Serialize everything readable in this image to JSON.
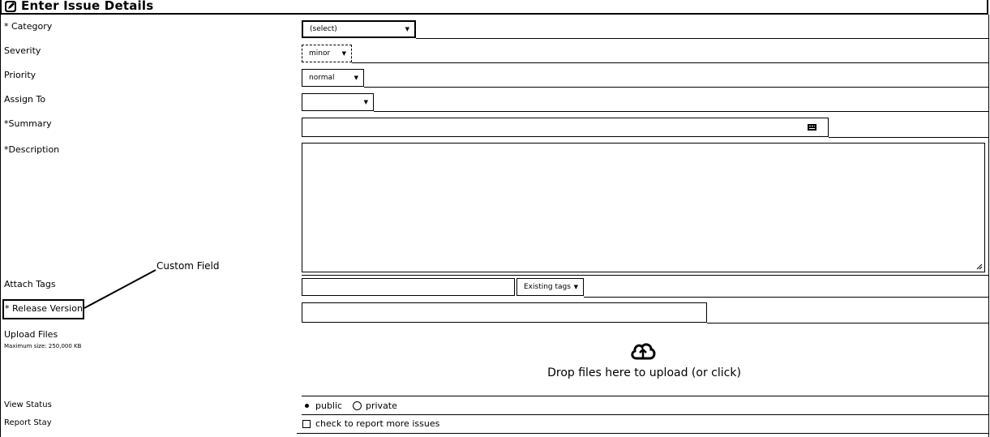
{
  "title": "Enter Issue Details",
  "icons": {
    "title": "edit-icon",
    "summary_field": "keyboard-icon",
    "upload": "cloud-upload-icon",
    "resize": "resize-grip-icon"
  },
  "fields": {
    "category": {
      "label": "* Category",
      "value": "(select)"
    },
    "severity": {
      "label": "Severity",
      "value": "minor"
    },
    "priority": {
      "label": "Priority",
      "value": "normal"
    },
    "assign_to": {
      "label": "Assign To",
      "value": ""
    },
    "summary": {
      "label": "*Summary",
      "value": ""
    },
    "description": {
      "label": "*Description",
      "value": ""
    },
    "attach_tags": {
      "label": "Attach Tags",
      "value": "",
      "existing_tags_label": "Existing tags"
    },
    "release_version": {
      "label": "* Release Version",
      "value": ""
    },
    "upload_files": {
      "label": "Upload Files",
      "max_size": "Maximum size: 250,000 KB",
      "drop_text": "Drop files here to upload (or click)"
    },
    "view_status": {
      "label": "View Status",
      "options": [
        "public",
        "private"
      ],
      "selected": "public"
    },
    "report_stay": {
      "label": "Report Stay",
      "checkbox_label": "check to report more issues",
      "checked": false
    }
  },
  "annotation": {
    "text": "Custom Field"
  }
}
